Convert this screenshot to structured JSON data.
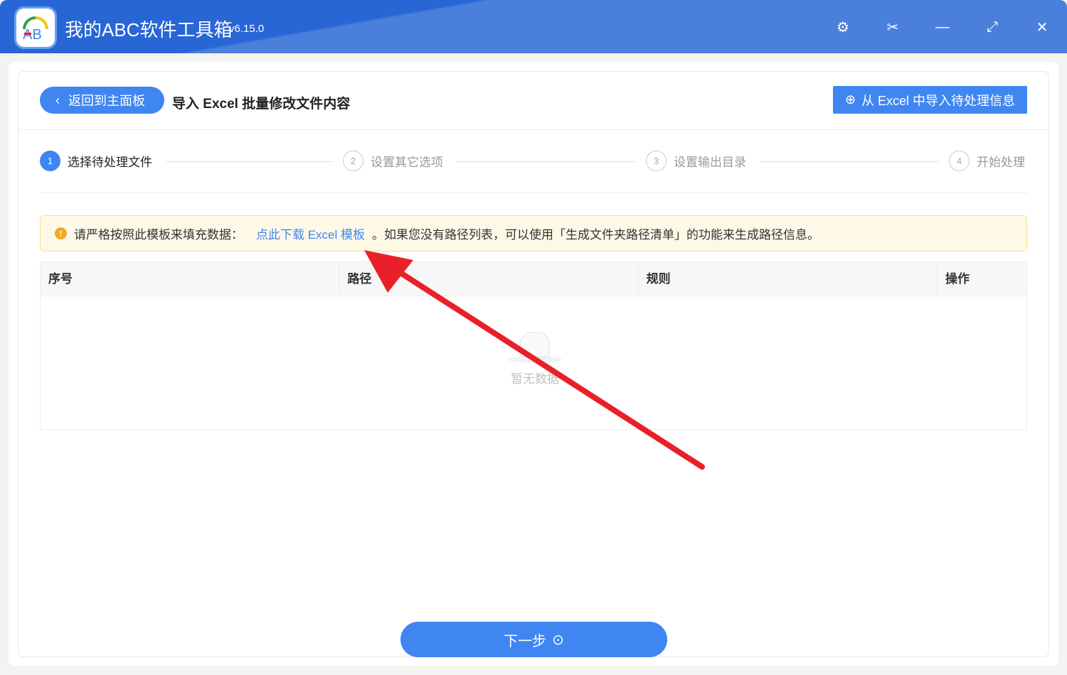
{
  "app": {
    "title": "我的ABC软件工具箱",
    "version": "v6.15.0"
  },
  "header": {
    "back_label": "返回到主面板",
    "page_title": "导入 Excel 批量修改文件内容",
    "import_label": "从 Excel 中导入待处理信息"
  },
  "steps": [
    {
      "num": "1",
      "label": "选择待处理文件"
    },
    {
      "num": "2",
      "label": "设置其它选项"
    },
    {
      "num": "3",
      "label": "设置输出目录"
    },
    {
      "num": "4",
      "label": "开始处理"
    }
  ],
  "notice": {
    "prefix": "请严格按照此模板来填充数据：",
    "link": "点此下载 Excel 模板",
    "suffix": "。如果您没有路径列表，可以使用「生成文件夹路径清单」的功能来生成路径信息。"
  },
  "table": {
    "headers": [
      "序号",
      "路径",
      "规则",
      "操作"
    ],
    "empty_text": "暂无数据"
  },
  "footer": {
    "next_label": "下一步"
  },
  "colors": {
    "accent": "#3f86f2",
    "titlebar": "#2866d6",
    "annotation": "#e8202a"
  }
}
